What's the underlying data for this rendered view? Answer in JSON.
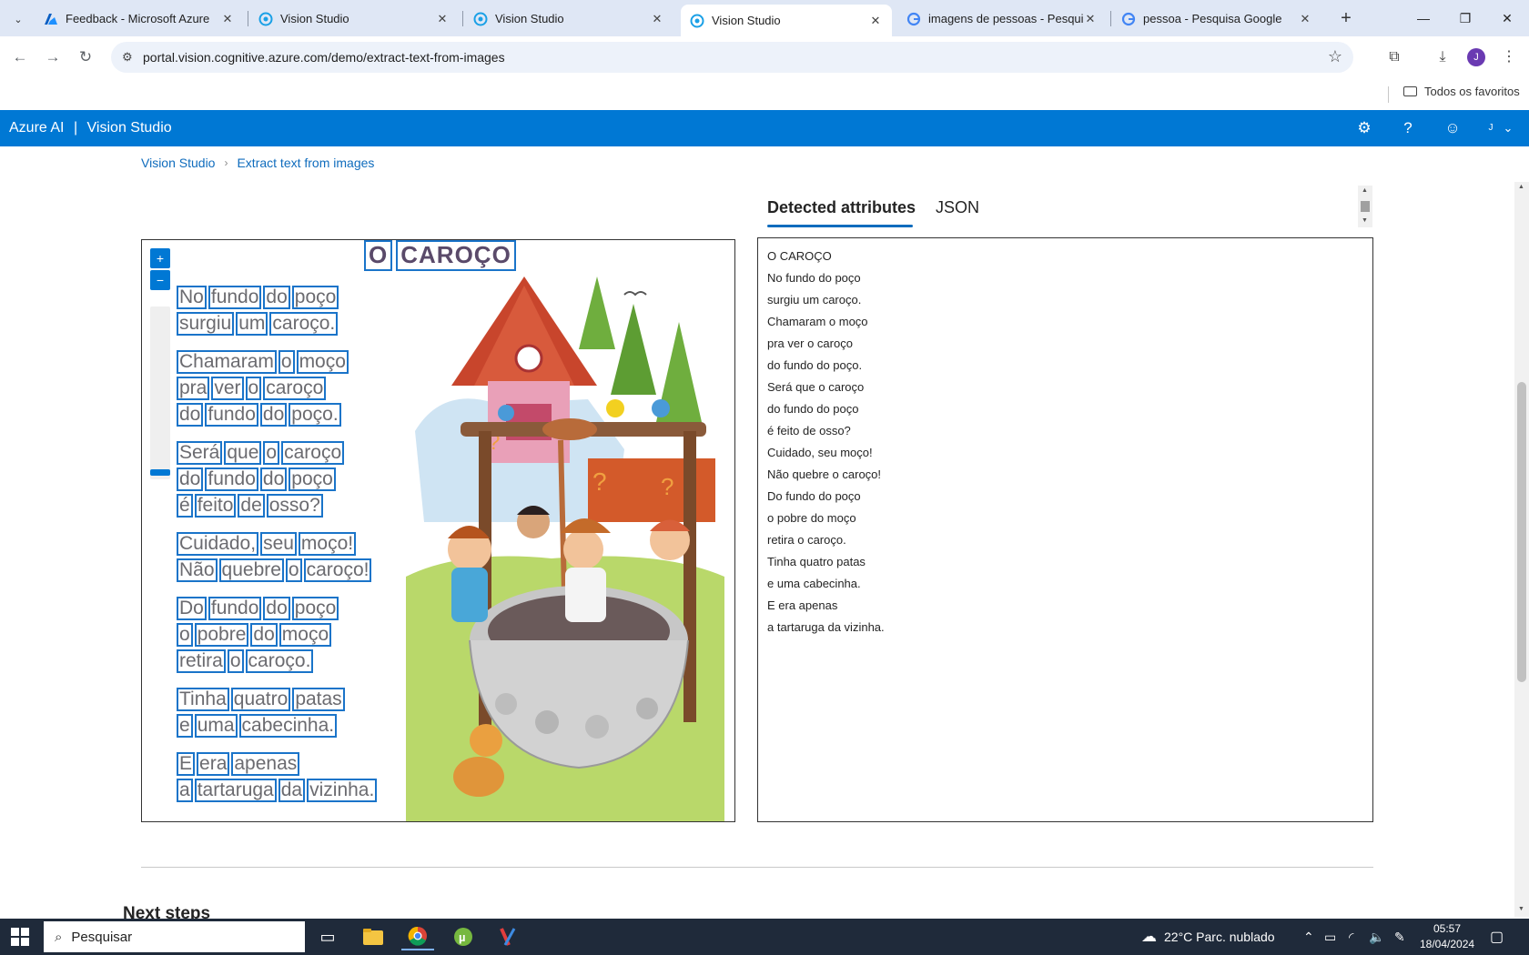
{
  "browser": {
    "tabs": [
      {
        "title": "Feedback - Microsoft Azure",
        "icon": "azure-logo-icon",
        "active": false
      },
      {
        "title": "Vision Studio",
        "icon": "vision-studio-icon",
        "active": false
      },
      {
        "title": "Vision Studio",
        "icon": "vision-studio-icon",
        "active": false
      },
      {
        "title": "Vision Studio",
        "icon": "vision-studio-icon",
        "active": true
      },
      {
        "title": "imagens de pessoas - Pesquisa",
        "icon": "google-icon",
        "active": false
      },
      {
        "title": "pessoa - Pesquisa Google",
        "icon": "google-icon",
        "active": false
      }
    ],
    "url": "portal.vision.cognitive.azure.com/demo/extract-text-from-images",
    "profile_initial": "J",
    "bookmarks_folder": "Todos os favoritos"
  },
  "app": {
    "brand": "Azure AI",
    "separator": "|",
    "product": "Vision Studio",
    "account_initial": "J"
  },
  "breadcrumb": {
    "home": "Vision Studio",
    "current": "Extract text from images"
  },
  "result_tabs": {
    "detected": "Detected attributes",
    "json": "JSON"
  },
  "image_panel": {
    "zoom_in": "+",
    "zoom_out": "−",
    "poem_title_words": [
      "O",
      "CAROÇO"
    ],
    "stanzas": [
      [
        [
          "No",
          "fundo",
          "do",
          "poço"
        ],
        [
          "surgiu",
          "um",
          "caroço."
        ]
      ],
      [
        [
          "Chamaram",
          "o",
          "moço"
        ],
        [
          "pra",
          "ver",
          "o",
          "caroço"
        ],
        [
          "do",
          "fundo",
          "do",
          "poço."
        ]
      ],
      [
        [
          "Será",
          "que",
          "o",
          "caroço"
        ],
        [
          "do",
          "fundo",
          "do",
          "poço"
        ],
        [
          "é",
          "feito",
          "de",
          "osso?"
        ]
      ],
      [
        [
          "Cuidado,",
          "seu",
          "moço!"
        ],
        [
          "Não",
          "quebre",
          "o",
          "caroço!"
        ]
      ],
      [
        [
          "Do",
          "fundo",
          "do",
          "poço"
        ],
        [
          "o",
          "pobre",
          "do",
          "moço"
        ],
        [
          "retira",
          "o",
          "caroço."
        ]
      ],
      [
        [
          "Tinha",
          "quatro",
          "patas"
        ],
        [
          "e",
          "uma",
          "cabecinha."
        ]
      ],
      [
        [
          "E",
          "era",
          "apenas"
        ],
        [
          "a",
          "tartaruga",
          "da",
          "vizinha."
        ]
      ]
    ]
  },
  "extracted_text": [
    "O CAROÇO",
    "No fundo do poço",
    "surgiu um caroço.",
    "Chamaram o moço",
    "pra ver o caroço",
    "do fundo do poço.",
    "Será que o caroço",
    "do fundo do poço",
    "é feito de osso?",
    "Cuidado, seu moço!",
    "Não quebre o caroço!",
    "Do fundo do poço",
    "o pobre do moço",
    "retira o caroço.",
    "Tinha quatro patas",
    "e uma cabecinha.",
    "E era apenas",
    "a tartaruga da vizinha."
  ],
  "next_steps": "Next steps",
  "taskbar": {
    "search_placeholder": "Pesquisar",
    "weather": "22°C  Parc. nublado",
    "time": "05:57",
    "date": "18/04/2024"
  },
  "colors": {
    "azure_blue": "#0078d4",
    "link_blue": "#0f6cbd",
    "ocr_box": "#1a74c9"
  }
}
